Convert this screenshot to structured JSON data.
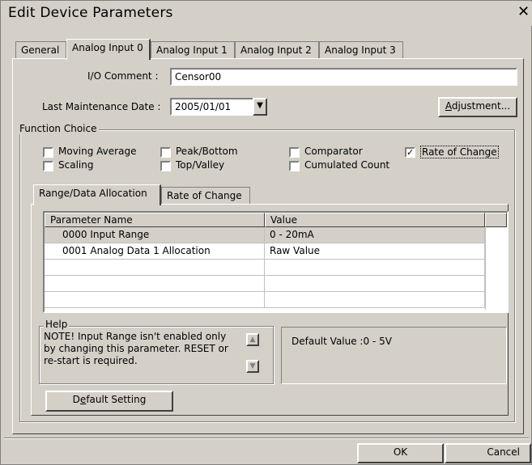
{
  "window": {
    "title": "Edit Device Parameters",
    "close_label": "✕"
  },
  "top_tabs": [
    {
      "label": "General"
    },
    {
      "label": "Analog Input 0"
    },
    {
      "label": "Analog Input 1"
    },
    {
      "label": "Analog Input 2"
    },
    {
      "label": "Analog Input 3"
    }
  ],
  "io_comment": {
    "label": "I/O Comment :",
    "value": "Censor00"
  },
  "maintenance": {
    "label": "Last Maintenance Date :",
    "value": "2005/01/01"
  },
  "adjustment_button": {
    "prefix": "",
    "accel": "A",
    "rest": "djustment..."
  },
  "function_choice": {
    "legend": "Function Choice",
    "options": [
      {
        "label": "Moving Average",
        "checked": false
      },
      {
        "label": "Peak/Bottom",
        "checked": false
      },
      {
        "label": "Comparator",
        "checked": false
      },
      {
        "label": "Rate of Change",
        "checked": true
      },
      {
        "label": "Scaling",
        "checked": false
      },
      {
        "label": "Top/Valley",
        "checked": false
      },
      {
        "label": "Cumulated Count",
        "checked": false
      }
    ]
  },
  "inner_tabs": [
    {
      "label": "Range/Data Allocation"
    },
    {
      "label": "Rate of Change"
    }
  ],
  "grid": {
    "columns": [
      "Parameter Name",
      "Value"
    ],
    "rows": [
      {
        "name": "0000 Input Range",
        "value": "0 - 20mA"
      },
      {
        "name": "0001 Analog Data 1 Allocation",
        "value": "Raw Value"
      }
    ]
  },
  "help": {
    "legend": "Help",
    "lines": [
      "NOTE! Input Range isn't enabled only",
      "by changing this parameter. RESET or",
      "re-start is required."
    ],
    "default_value": "Default Value :0 - 5V"
  },
  "default_setting_button": {
    "prefix": "D",
    "accel": "e",
    "rest": "fault Setting"
  },
  "ok_label": "OK",
  "cancel_label": "Cancel"
}
